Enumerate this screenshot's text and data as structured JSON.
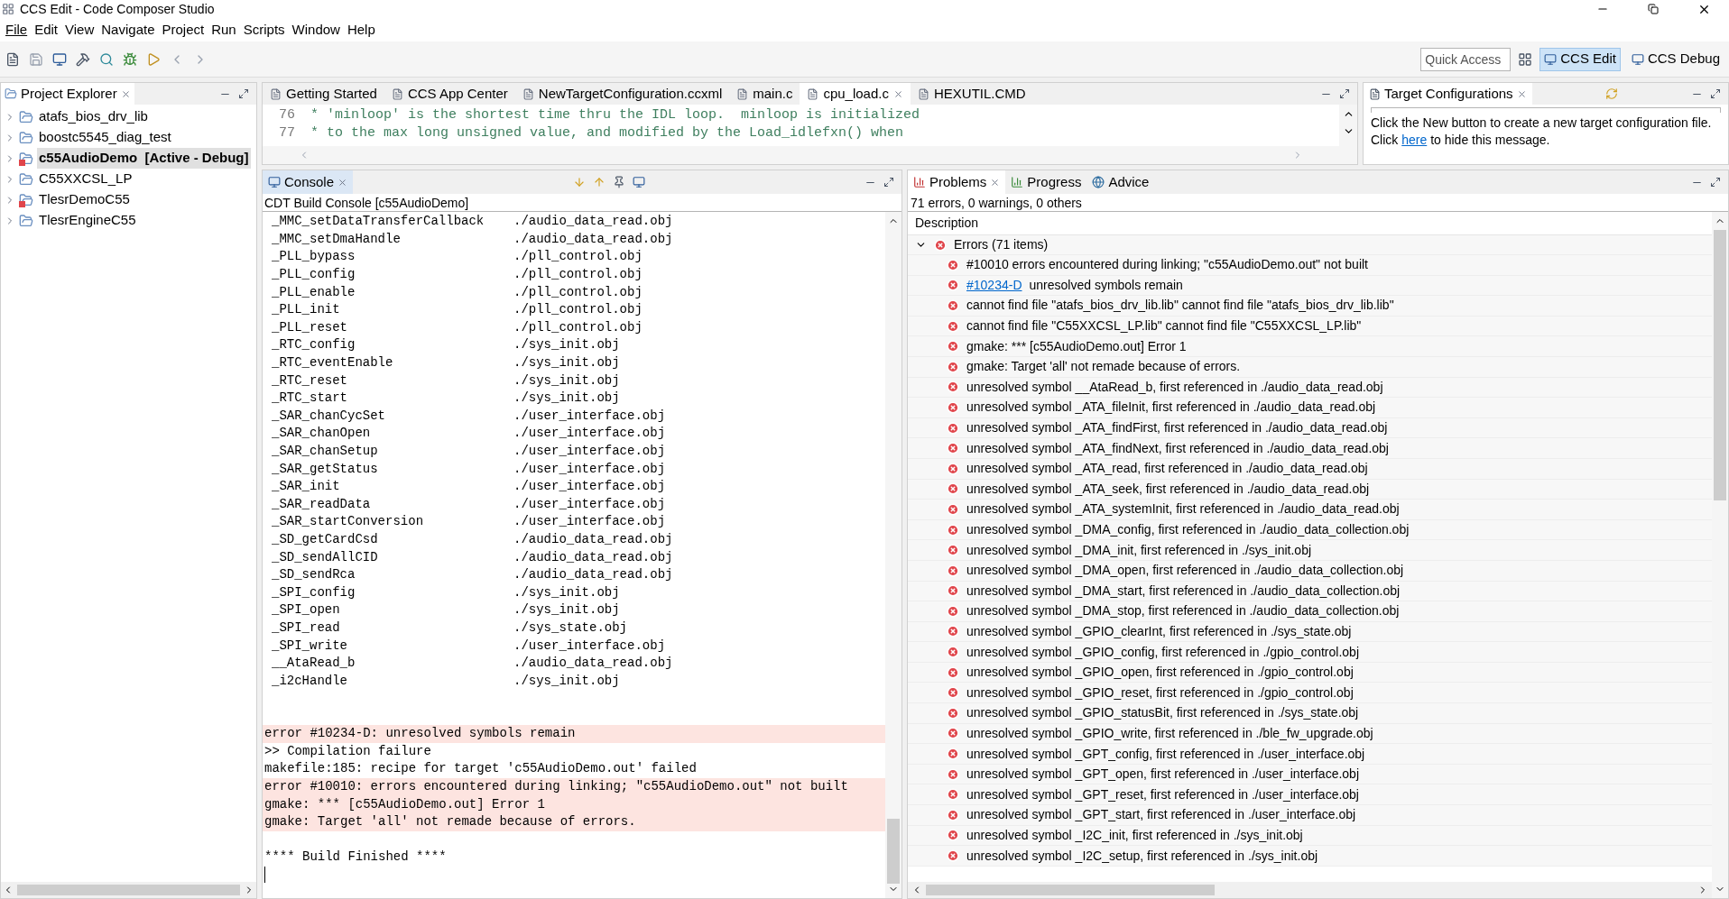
{
  "window": {
    "title": "CCS Edit - Code Composer Studio"
  },
  "menu": [
    {
      "label": "File",
      "selected": true
    },
    {
      "label": "Edit",
      "selected": false
    },
    {
      "label": "View",
      "selected": false
    },
    {
      "label": "Navigate",
      "selected": false
    },
    {
      "label": "Project",
      "selected": false
    },
    {
      "label": "Run",
      "selected": false
    },
    {
      "label": "Scripts",
      "selected": false
    },
    {
      "label": "Window",
      "selected": false
    },
    {
      "label": "Help",
      "selected": false
    }
  ],
  "quick_access": {
    "placeholder": "Quick Access"
  },
  "perspectives": [
    {
      "label": "CCS Edit",
      "selected": true
    },
    {
      "label": "CCS Debug",
      "selected": false
    }
  ],
  "project_explorer": {
    "title": "Project Explorer",
    "items": [
      {
        "name": "atafs_bios_drv_lib",
        "selected": false,
        "error": false
      },
      {
        "name": "boostc5545_diag_test",
        "selected": false,
        "error": false
      },
      {
        "name": "c55AudioDemo  [Active - Debug]",
        "selected": true,
        "error": true
      },
      {
        "name": "C55XXCSL_LP",
        "selected": false,
        "error": false
      },
      {
        "name": "TlesrDemoC55",
        "selected": false,
        "error": true
      },
      {
        "name": "TlesrEngineC55",
        "selected": false,
        "error": false
      }
    ]
  },
  "editor": {
    "tabs": [
      {
        "label": "Getting Started",
        "selected": false
      },
      {
        "label": "CCS App Center",
        "selected": false
      },
      {
        "label": "NewTargetConfiguration.ccxml",
        "selected": false
      },
      {
        "label": "main.c",
        "selected": false
      },
      {
        "label": "cpu_load.c",
        "selected": true
      },
      {
        "label": "HEXUTIL.CMD",
        "selected": false
      }
    ],
    "lines": [
      {
        "number": "76",
        "text": " * 'minloop' is the shortest time thru the IDL loop.  minloop is initialized"
      },
      {
        "number": "77",
        "text": " * to the max long unsigned value, and modified by the Load_idlefxn() when"
      }
    ]
  },
  "target_configurations": {
    "title": "Target Configurations",
    "message_before": "Click the New button to create a new target configuration file. Click ",
    "link": "here",
    "message_after": " to hide this message."
  },
  "console": {
    "title": "Console",
    "subtitle": "CDT Build Console [c55AudioDemo]",
    "lines": [
      {
        "kind": "symbol",
        "symbol": "_MMC_setDataTransferCallback",
        "file": "./audio_data_read.obj"
      },
      {
        "kind": "symbol",
        "symbol": "_MMC_setDmaHandle",
        "file": "./audio_data_read.obj"
      },
      {
        "kind": "symbol",
        "symbol": "_PLL_bypass",
        "file": "./pll_control.obj"
      },
      {
        "kind": "symbol",
        "symbol": "_PLL_config",
        "file": "./pll_control.obj"
      },
      {
        "kind": "symbol",
        "symbol": "_PLL_enable",
        "file": "./pll_control.obj"
      },
      {
        "kind": "symbol",
        "symbol": "_PLL_init",
        "file": "./pll_control.obj"
      },
      {
        "kind": "symbol",
        "symbol": "_PLL_reset",
        "file": "./pll_control.obj"
      },
      {
        "kind": "symbol",
        "symbol": "_RTC_config",
        "file": "./sys_init.obj"
      },
      {
        "kind": "symbol",
        "symbol": "_RTC_eventEnable",
        "file": "./sys_init.obj"
      },
      {
        "kind": "symbol",
        "symbol": "_RTC_reset",
        "file": "./sys_init.obj"
      },
      {
        "kind": "symbol",
        "symbol": "_RTC_start",
        "file": "./sys_init.obj"
      },
      {
        "kind": "symbol",
        "symbol": "_SAR_chanCycSet",
        "file": "./user_interface.obj"
      },
      {
        "kind": "symbol",
        "symbol": "_SAR_chanOpen",
        "file": "./user_interface.obj"
      },
      {
        "kind": "symbol",
        "symbol": "_SAR_chanSetup",
        "file": "./user_interface.obj"
      },
      {
        "kind": "symbol",
        "symbol": "_SAR_getStatus",
        "file": "./user_interface.obj"
      },
      {
        "kind": "symbol",
        "symbol": "_SAR_init",
        "file": "./user_interface.obj"
      },
      {
        "kind": "symbol",
        "symbol": "_SAR_readData",
        "file": "./user_interface.obj"
      },
      {
        "kind": "symbol",
        "symbol": "_SAR_startConversion",
        "file": "./user_interface.obj"
      },
      {
        "kind": "symbol",
        "symbol": "_SD_getCardCsd",
        "file": "./audio_data_read.obj"
      },
      {
        "kind": "symbol",
        "symbol": "_SD_sendAllCID",
        "file": "./audio_data_read.obj"
      },
      {
        "kind": "symbol",
        "symbol": "_SD_sendRca",
        "file": "./audio_data_read.obj"
      },
      {
        "kind": "symbol",
        "symbol": "_SPI_config",
        "file": "./sys_init.obj"
      },
      {
        "kind": "symbol",
        "symbol": "_SPI_open",
        "file": "./sys_init.obj"
      },
      {
        "kind": "symbol",
        "symbol": "_SPI_read",
        "file": "./sys_state.obj"
      },
      {
        "kind": "symbol",
        "symbol": "_SPI_write",
        "file": "./user_interface.obj"
      },
      {
        "kind": "symbol",
        "symbol": "__AtaRead_b",
        "file": "./audio_data_read.obj"
      },
      {
        "kind": "symbol",
        "symbol": "_i2cHandle",
        "file": "./sys_init.obj"
      },
      {
        "kind": "blank"
      },
      {
        "kind": "blank"
      },
      {
        "kind": "output",
        "text": "error #10234-D: unresolved symbols remain",
        "error": true
      },
      {
        "kind": "output",
        "text": ">> Compilation failure",
        "error": false
      },
      {
        "kind": "output",
        "text": "makefile:185: recipe for target 'c55AudioDemo.out' failed",
        "error": false
      },
      {
        "kind": "output",
        "text": "error #10010: errors encountered during linking; \"c55AudioDemo.out\" not built",
        "error": true
      },
      {
        "kind": "output",
        "text": "gmake: *** [c55AudioDemo.out] Error 1",
        "error": true
      },
      {
        "kind": "output",
        "text": "gmake: Target 'all' not remade because of errors.",
        "error": true
      },
      {
        "kind": "blank"
      },
      {
        "kind": "output",
        "text": "**** Build Finished ****",
        "error": false
      }
    ]
  },
  "problems": {
    "tabs": [
      {
        "label": "Problems",
        "selected": true
      },
      {
        "label": "Progress",
        "selected": false
      },
      {
        "label": "Advice",
        "selected": false
      }
    ],
    "summary": "71 errors, 0 warnings, 0 others",
    "column": "Description",
    "group": {
      "label": "Errors (71 items)",
      "expanded": true
    },
    "items": [
      {
        "text": "#10010 errors encountered during linking; \"c55AudioDemo.out\" not built"
      },
      {
        "link": "#10234-D",
        "text": "unresolved symbols remain"
      },
      {
        "text": "cannot find file \"atafs_bios_drv_lib.lib\" cannot find file \"atafs_bios_drv_lib.lib\""
      },
      {
        "text": "cannot find file \"C55XXCSL_LP.lib\" cannot find file \"C55XXCSL_LP.lib\""
      },
      {
        "text": "gmake: *** [c55AudioDemo.out] Error 1"
      },
      {
        "text": "gmake: Target 'all' not remade because of errors."
      },
      {
        "text": "unresolved symbol __AtaRead_b, first referenced in ./audio_data_read.obj"
      },
      {
        "text": "unresolved symbol _ATA_fileInit, first referenced in ./audio_data_read.obj"
      },
      {
        "text": "unresolved symbol _ATA_findFirst, first referenced in ./audio_data_read.obj"
      },
      {
        "text": "unresolved symbol _ATA_findNext, first referenced in ./audio_data_read.obj"
      },
      {
        "text": "unresolved symbol _ATA_read, first referenced in ./audio_data_read.obj"
      },
      {
        "text": "unresolved symbol _ATA_seek, first referenced in ./audio_data_read.obj"
      },
      {
        "text": "unresolved symbol _ATA_systemInit, first referenced in ./audio_data_read.obj"
      },
      {
        "text": "unresolved symbol _DMA_config, first referenced in ./audio_data_collection.obj"
      },
      {
        "text": "unresolved symbol _DMA_init, first referenced in ./sys_init.obj"
      },
      {
        "text": "unresolved symbol _DMA_open, first referenced in ./audio_data_collection.obj"
      },
      {
        "text": "unresolved symbol _DMA_start, first referenced in ./audio_data_collection.obj"
      },
      {
        "text": "unresolved symbol _DMA_stop, first referenced in ./audio_data_collection.obj"
      },
      {
        "text": "unresolved symbol _GPIO_clearInt, first referenced in ./sys_state.obj"
      },
      {
        "text": "unresolved symbol _GPIO_config, first referenced in ./gpio_control.obj"
      },
      {
        "text": "unresolved symbol _GPIO_open, first referenced in ./gpio_control.obj"
      },
      {
        "text": "unresolved symbol _GPIO_reset, first referenced in ./gpio_control.obj"
      },
      {
        "text": "unresolved symbol _GPIO_statusBit, first referenced in ./sys_state.obj"
      },
      {
        "text": "unresolved symbol _GPIO_write, first referenced in ./ble_fw_upgrade.obj"
      },
      {
        "text": "unresolved symbol _GPT_config, first referenced in ./user_interface.obj"
      },
      {
        "text": "unresolved symbol _GPT_open, first referenced in ./user_interface.obj"
      },
      {
        "text": "unresolved symbol _GPT_reset, first referenced in ./user_interface.obj"
      },
      {
        "text": "unresolved symbol _GPT_start, first referenced in ./user_interface.obj"
      },
      {
        "text": "unresolved symbol _I2C_init, first referenced in ./sys_init.obj"
      },
      {
        "text": "unresolved symbol _I2C_setup, first referenced in ./sys_init.obj"
      }
    ]
  }
}
